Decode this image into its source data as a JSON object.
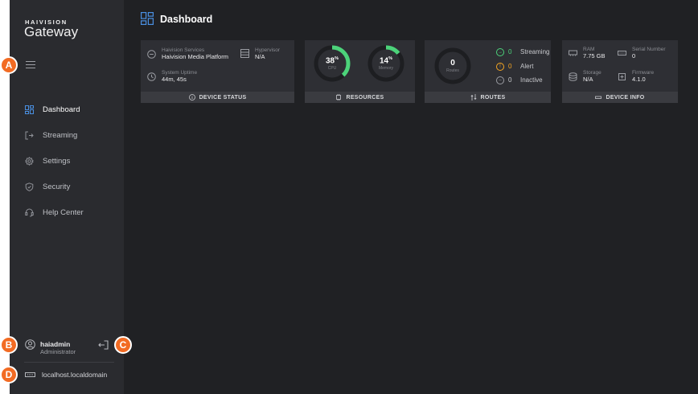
{
  "sidebar": {
    "brand_small": "HAIVISION",
    "brand_large": "Gateway",
    "nav": [
      {
        "label": "Dashboard",
        "icon": "dashboard-icon",
        "active": true
      },
      {
        "label": "Streaming",
        "icon": "streaming-icon",
        "active": false
      },
      {
        "label": "Settings",
        "icon": "gear-icon",
        "active": false
      },
      {
        "label": "Security",
        "icon": "shield-icon",
        "active": false
      },
      {
        "label": "Help Center",
        "icon": "help-icon",
        "active": false
      }
    ],
    "user": {
      "name": "haiadmin",
      "role": "Administrator"
    },
    "host": "localhost.localdomain"
  },
  "callouts": {
    "a": "A",
    "b": "B",
    "c": "C",
    "d": "D"
  },
  "header": {
    "title": "Dashboard"
  },
  "device_status": {
    "services_label": "Haivision Services",
    "services_value": "Haivision Media Platform",
    "hypervisor_label": "Hypervisor",
    "hypervisor_value": "N/A",
    "uptime_label": "System Uptime",
    "uptime_value": "44m, 45s",
    "footer": "DEVICE STATUS"
  },
  "resources": {
    "cpu": {
      "value": "38",
      "unit": "%",
      "label": "CPU",
      "fraction": 0.38
    },
    "memory": {
      "value": "14",
      "unit": "%",
      "label": "Memory",
      "fraction": 0.14
    },
    "footer": "RESOURCES"
  },
  "routes": {
    "total": "0",
    "total_label": "Routes",
    "streaming_count": "0",
    "streaming_label": "Streaming",
    "alert_count": "0",
    "alert_label": "Alert",
    "inactive_count": "0",
    "inactive_label": "Inactive",
    "footer": "ROUTES"
  },
  "device_info": {
    "ram_label": "RAM",
    "ram_value": "7.75 GB",
    "serial_label": "Serial Number",
    "serial_value": "0",
    "storage_label": "Storage",
    "storage_value": "N/A",
    "firmware_label": "Firmware",
    "firmware_value": "4.1.0",
    "footer": "DEVICE INFO"
  },
  "colors": {
    "accent_blue": "#4a90e2",
    "gauge_green": "#4cd37a",
    "alert_orange": "#f5a623",
    "callout_orange": "#f26b23"
  }
}
